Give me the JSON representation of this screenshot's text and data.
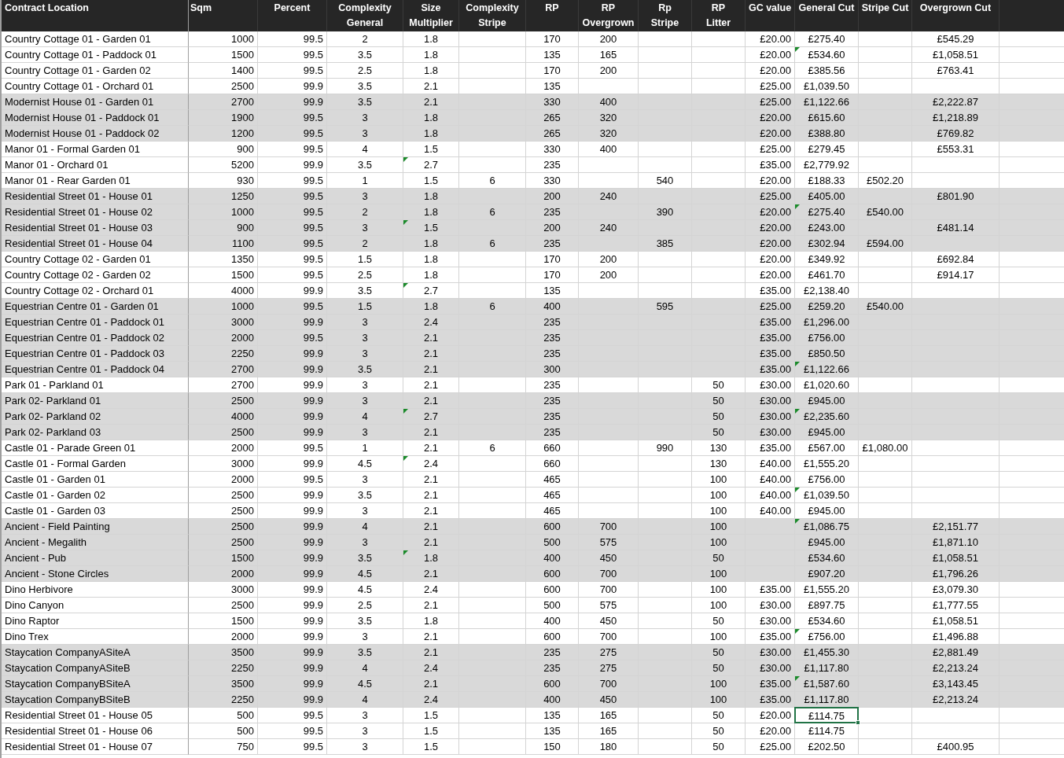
{
  "table": {
    "columns": [
      "Contract Location",
      "Sqm",
      "Percent",
      "Complexity General",
      "Size Multiplier",
      "Complexity Stripe",
      "RP",
      "RP Overgrown",
      "Rp Stripe",
      "RP Litter",
      "GC value",
      "General Cut",
      "Stripe Cut",
      "Overgrown Cut"
    ],
    "rows": [
      {
        "band": false,
        "cells": [
          "Country Cottage 01 - Garden 01",
          "1000",
          "99.5",
          "2",
          "1.8",
          null,
          "170",
          "200",
          null,
          null,
          "£20.00",
          "£275.40",
          null,
          "£545.29"
        ]
      },
      {
        "band": false,
        "cells": [
          "Country Cottage 01 - Paddock 01",
          "1500",
          "99.5",
          "3.5",
          "1.8",
          null,
          "135",
          "165",
          null,
          null,
          "£20.00",
          {
            "text": "£534.60",
            "flag": true
          },
          null,
          "£1,058.51"
        ]
      },
      {
        "band": false,
        "cells": [
          "Country Cottage 01 - Garden 02",
          "1400",
          "99.5",
          "2.5",
          "1.8",
          null,
          "170",
          "200",
          null,
          null,
          "£20.00",
          "£385.56",
          null,
          "£763.41"
        ]
      },
      {
        "band": false,
        "cells": [
          "Country Cottage 01 - Orchard 01",
          "2500",
          "99.9",
          "3.5",
          "2.1",
          null,
          "135",
          null,
          null,
          null,
          "£25.00",
          "£1,039.50",
          null,
          null
        ]
      },
      {
        "band": true,
        "cells": [
          "Modernist House 01 - Garden 01",
          "2700",
          "99.9",
          "3.5",
          "2.1",
          null,
          "330",
          "400",
          null,
          null,
          "£25.00",
          "£1,122.66",
          null,
          "£2,222.87"
        ]
      },
      {
        "band": true,
        "cells": [
          "Modernist House 01 - Paddock 01",
          "1900",
          "99.5",
          "3",
          "1.8",
          null,
          "265",
          "320",
          null,
          null,
          "£20.00",
          "£615.60",
          null,
          "£1,218.89"
        ]
      },
      {
        "band": true,
        "cells": [
          "Modernist House 01 - Paddock 02",
          "1200",
          "99.5",
          "3",
          "1.8",
          null,
          "265",
          "320",
          null,
          null,
          "£20.00",
          "£388.80",
          null,
          "£769.82"
        ]
      },
      {
        "band": false,
        "cells": [
          "Manor 01 - Formal Garden 01",
          "900",
          "99.5",
          "4",
          "1.5",
          null,
          "330",
          "400",
          null,
          null,
          "£25.00",
          "£279.45",
          null,
          "£553.31"
        ]
      },
      {
        "band": false,
        "cells": [
          "Manor 01 - Orchard 01",
          "5200",
          "99.9",
          "3.5",
          {
            "text": "2.7",
            "flag": true
          },
          null,
          "235",
          null,
          null,
          null,
          "£35.00",
          "£2,779.92",
          null,
          null
        ]
      },
      {
        "band": false,
        "cells": [
          "Manor 01 - Rear Garden 01",
          "930",
          "99.5",
          "1",
          "1.5",
          "6",
          "330",
          null,
          "540",
          null,
          "£20.00",
          "£188.33",
          "£502.20",
          null
        ]
      },
      {
        "band": true,
        "cells": [
          "Residential Street 01 - House 01",
          "1250",
          "99.5",
          "3",
          "1.8",
          null,
          "200",
          "240",
          null,
          null,
          "£25.00",
          "£405.00",
          null,
          "£801.90"
        ]
      },
      {
        "band": true,
        "cells": [
          "Residential Street 01 - House 02",
          "1000",
          "99.5",
          "2",
          "1.8",
          "6",
          "235",
          null,
          "390",
          null,
          "£20.00",
          {
            "text": "£275.40",
            "flag": true
          },
          "£540.00",
          null
        ]
      },
      {
        "band": true,
        "cells": [
          "Residential Street 01 - House 03",
          "900",
          "99.5",
          "3",
          {
            "text": "1.5",
            "flag": true
          },
          null,
          "200",
          "240",
          null,
          null,
          "£20.00",
          "£243.00",
          null,
          "£481.14"
        ]
      },
      {
        "band": true,
        "cells": [
          "Residential Street 01 - House 04",
          "1100",
          "99.5",
          "2",
          "1.8",
          "6",
          "235",
          null,
          "385",
          null,
          "£20.00",
          "£302.94",
          "£594.00",
          null
        ]
      },
      {
        "band": false,
        "cells": [
          "Country Cottage 02 - Garden 01",
          "1350",
          "99.5",
          "1.5",
          "1.8",
          null,
          "170",
          "200",
          null,
          null,
          "£20.00",
          "£349.92",
          null,
          "£692.84"
        ]
      },
      {
        "band": false,
        "cells": [
          "Country Cottage 02 - Garden 02",
          "1500",
          "99.5",
          "2.5",
          "1.8",
          null,
          "170",
          "200",
          null,
          null,
          "£20.00",
          "£461.70",
          null,
          "£914.17"
        ]
      },
      {
        "band": false,
        "cells": [
          "Country Cottage 02 - Orchard 01",
          "4000",
          "99.9",
          "3.5",
          {
            "text": "2.7",
            "flag": true
          },
          null,
          "135",
          null,
          null,
          null,
          "£35.00",
          "£2,138.40",
          null,
          null
        ]
      },
      {
        "band": true,
        "cells": [
          "Equestrian Centre 01 - Garden 01",
          "1000",
          "99.5",
          "1.5",
          "1.8",
          "6",
          "400",
          null,
          "595",
          null,
          "£25.00",
          "£259.20",
          "£540.00",
          null
        ]
      },
      {
        "band": true,
        "cells": [
          "Equestrian Centre 01 - Paddock 01",
          "3000",
          "99.9",
          "3",
          "2.4",
          null,
          "235",
          null,
          null,
          null,
          "£35.00",
          "£1,296.00",
          null,
          null
        ]
      },
      {
        "band": true,
        "cells": [
          "Equestrian Centre 01 - Paddock 02",
          "2000",
          "99.5",
          "3",
          "2.1",
          null,
          "235",
          null,
          null,
          null,
          "£35.00",
          "£756.00",
          null,
          null
        ]
      },
      {
        "band": true,
        "cells": [
          "Equestrian Centre 01 - Paddock 03",
          "2250",
          "99.9",
          "3",
          "2.1",
          null,
          "235",
          null,
          null,
          null,
          "£35.00",
          "£850.50",
          null,
          null
        ]
      },
      {
        "band": true,
        "cells": [
          "Equestrian Centre 01 - Paddock 04",
          "2700",
          "99.9",
          "3.5",
          "2.1",
          null,
          "300",
          null,
          null,
          null,
          "£35.00",
          {
            "text": "£1,122.66",
            "flag": true
          },
          null,
          null
        ]
      },
      {
        "band": false,
        "cells": [
          "Park 01 - Parkland 01",
          "2700",
          "99.9",
          "3",
          "2.1",
          null,
          "235",
          null,
          null,
          "50",
          "£30.00",
          "£1,020.60",
          null,
          null
        ]
      },
      {
        "band": true,
        "cells": [
          "Park 02- Parkland 01",
          "2500",
          "99.9",
          "3",
          "2.1",
          null,
          "235",
          null,
          null,
          "50",
          "£30.00",
          "£945.00",
          null,
          null
        ]
      },
      {
        "band": true,
        "cells": [
          "Park 02- Parkland 02",
          "4000",
          "99.9",
          "4",
          {
            "text": "2.7",
            "flag": true
          },
          null,
          "235",
          null,
          null,
          "50",
          "£30.00",
          {
            "text": "£2,235.60",
            "flag": true
          },
          null,
          null
        ]
      },
      {
        "band": true,
        "cells": [
          "Park 02- Parkland 03",
          "2500",
          "99.9",
          "3",
          "2.1",
          null,
          "235",
          null,
          null,
          "50",
          "£30.00",
          "£945.00",
          null,
          null
        ]
      },
      {
        "band": false,
        "cells": [
          "Castle 01 - Parade Green 01",
          "2000",
          "99.5",
          "1",
          "2.1",
          "6",
          "660",
          null,
          "990",
          "130",
          "£35.00",
          "£567.00",
          "£1,080.00",
          null
        ]
      },
      {
        "band": false,
        "cells": [
          "Castle 01 - Formal Garden",
          "3000",
          "99.9",
          "4.5",
          {
            "text": "2.4",
            "flag": true
          },
          null,
          "660",
          null,
          null,
          "130",
          "£40.00",
          "£1,555.20",
          null,
          null
        ]
      },
      {
        "band": false,
        "cells": [
          "Castle 01 - Garden 01",
          "2000",
          "99.5",
          "3",
          "2.1",
          null,
          "465",
          null,
          null,
          "100",
          "£40.00",
          "£756.00",
          null,
          null
        ]
      },
      {
        "band": false,
        "cells": [
          "Castle 01 - Garden 02",
          "2500",
          "99.9",
          "3.5",
          "2.1",
          null,
          "465",
          null,
          null,
          "100",
          "£40.00",
          {
            "text": "£1,039.50",
            "flag": true
          },
          null,
          null
        ]
      },
      {
        "band": false,
        "cells": [
          "Castle 01 - Garden 03",
          "2500",
          "99.9",
          "3",
          "2.1",
          null,
          "465",
          null,
          null,
          "100",
          "£40.00",
          "£945.00",
          null,
          null
        ]
      },
      {
        "band": true,
        "cells": [
          "Ancient - Field Painting",
          "2500",
          "99.9",
          "4",
          "2.1",
          null,
          "600",
          "700",
          null,
          "100",
          null,
          {
            "text": "£1,086.75",
            "flag": true
          },
          null,
          "£2,151.77"
        ]
      },
      {
        "band": true,
        "cells": [
          "Ancient - Megalith",
          "2500",
          "99.9",
          "3",
          "2.1",
          null,
          "500",
          "575",
          null,
          "100",
          null,
          "£945.00",
          null,
          "£1,871.10"
        ]
      },
      {
        "band": true,
        "cells": [
          "Ancient - Pub",
          "1500",
          "99.9",
          "3.5",
          {
            "text": "1.8",
            "flag": true
          },
          null,
          "400",
          "450",
          null,
          "50",
          null,
          "£534.60",
          null,
          "£1,058.51"
        ]
      },
      {
        "band": true,
        "cells": [
          "Ancient - Stone Circles",
          "2000",
          "99.9",
          "4.5",
          "2.1",
          null,
          "600",
          "700",
          null,
          "100",
          null,
          "£907.20",
          null,
          "£1,796.26"
        ]
      },
      {
        "band": false,
        "cells": [
          "Dino Herbivore",
          "3000",
          "99.9",
          "4.5",
          "2.4",
          null,
          "600",
          "700",
          null,
          "100",
          "£35.00",
          "£1,555.20",
          null,
          "£3,079.30"
        ]
      },
      {
        "band": false,
        "cells": [
          "Dino Canyon",
          "2500",
          "99.9",
          "2.5",
          "2.1",
          null,
          "500",
          "575",
          null,
          "100",
          "£30.00",
          "£897.75",
          null,
          "£1,777.55"
        ]
      },
      {
        "band": false,
        "cells": [
          "Dino Raptor",
          "1500",
          "99.9",
          "3.5",
          "1.8",
          null,
          "400",
          "450",
          null,
          "50",
          "£30.00",
          "£534.60",
          null,
          "£1,058.51"
        ]
      },
      {
        "band": false,
        "cells": [
          "Dino Trex",
          "2000",
          "99.9",
          "3",
          "2.1",
          null,
          "600",
          "700",
          null,
          "100",
          "£35.00",
          {
            "text": "£756.00",
            "flag": true
          },
          null,
          "£1,496.88"
        ]
      },
      {
        "band": true,
        "cells": [
          "Staycation CompanyASiteA",
          "3500",
          "99.9",
          "3.5",
          "2.1",
          null,
          "235",
          "275",
          null,
          "50",
          "£30.00",
          "£1,455.30",
          null,
          "£2,881.49"
        ]
      },
      {
        "band": true,
        "cells": [
          "Staycation CompanyASiteB",
          "2250",
          "99.9",
          "4",
          "2.4",
          null,
          "235",
          "275",
          null,
          "50",
          "£30.00",
          "£1,117.80",
          null,
          "£2,213.24"
        ]
      },
      {
        "band": true,
        "cells": [
          "Staycation CompanyBSiteA",
          "3500",
          "99.9",
          "4.5",
          "2.1",
          null,
          "600",
          "700",
          null,
          "100",
          "£35.00",
          {
            "text": "£1,587.60",
            "flag": true
          },
          null,
          "£3,143.45"
        ]
      },
      {
        "band": true,
        "cells": [
          "Staycation CompanyBSiteB",
          "2250",
          "99.9",
          "4",
          "2.4",
          null,
          "400",
          "450",
          null,
          "100",
          "£35.00",
          "£1,117.80",
          null,
          "£2,213.24"
        ]
      },
      {
        "band": false,
        "cells": [
          "Residential Street 01 - House 05",
          "500",
          "99.5",
          "3",
          "1.5",
          null,
          "135",
          "165",
          null,
          "50",
          "£20.00",
          {
            "text": "£114.75",
            "selected": true
          },
          null,
          null
        ]
      },
      {
        "band": false,
        "cells": [
          "Residential Street 01 - House 06",
          "500",
          "99.5",
          "3",
          "1.5",
          null,
          "135",
          "165",
          null,
          "50",
          "£20.00",
          "£114.75",
          null,
          null
        ]
      },
      {
        "band": false,
        "cells": [
          "Residential Street 01 - House 07",
          "750",
          "99.5",
          "3",
          "1.5",
          null,
          "150",
          "180",
          null,
          "50",
          "£25.00",
          "£202.50",
          null,
          "£400.95"
        ]
      }
    ]
  }
}
